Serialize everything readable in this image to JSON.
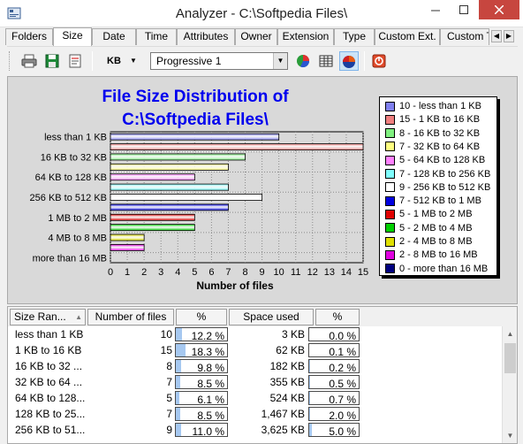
{
  "window": {
    "title": "Analyzer - C:\\Softpedia Files\\"
  },
  "tabs": [
    {
      "label": "Folders"
    },
    {
      "label": "Size"
    },
    {
      "label": "Date"
    },
    {
      "label": "Time"
    },
    {
      "label": "Attributes"
    },
    {
      "label": "Owner"
    },
    {
      "label": "Extension"
    },
    {
      "label": "Type"
    },
    {
      "label": "Custom Ext."
    },
    {
      "label": "Custom Type"
    }
  ],
  "active_tab": "Size",
  "toolbar": {
    "unit_label": "KB",
    "mode_value": "Progressive 1",
    "icons": [
      "print-icon",
      "save-icon",
      "properties-icon",
      "pie-chart-icon",
      "grid-icon",
      "bar-chart-icon",
      "stop-icon"
    ]
  },
  "chart_data": {
    "type": "bar",
    "orientation": "horizontal",
    "title_line1": "File Size Distribution of",
    "title_line2": "C:\\Softpedia Files\\",
    "xlabel": "Number of files",
    "xlim": [
      0,
      15
    ],
    "xticks": [
      "0",
      "1",
      "2",
      "3",
      "4",
      "5",
      "6",
      "7",
      "8",
      "9",
      "10",
      "11",
      "12",
      "13",
      "14",
      "15"
    ],
    "grid": true,
    "categories": [
      "less than 1 KB",
      "1 KB to 16 KB",
      "16 KB to 32 KB",
      "32 KB to 64 KB",
      "64 KB to 128 KB",
      "128 KB to 256 KB",
      "256 KB to 512 KB",
      "512 KB to 1 MB",
      "1 MB to 2 MB",
      "2 MB to 4 MB",
      "4 MB to 8 MB",
      "8 MB to 16 MB",
      "more than 16 MB"
    ],
    "tick_labels": [
      "less than 1 KB",
      "16 KB to 32 KB",
      "64 KB to 128 KB",
      "256 KB to 512 KB",
      "1 MB to 2 MB",
      "4 MB to 8 MB",
      "more than 16 MB"
    ],
    "values": [
      10,
      15,
      8,
      7,
      5,
      7,
      9,
      7,
      5,
      5,
      2,
      2,
      0
    ],
    "colors": [
      "#8080f0",
      "#f08080",
      "#80f080",
      "#ffff80",
      "#ff80ff",
      "#80ffff",
      "#ffffff",
      "#0000e0",
      "#e00000",
      "#00d000",
      "#e0e000",
      "#e000e0",
      "#000080"
    ],
    "legend_position": "right",
    "legend": [
      "10 - less than 1 KB",
      "15 - 1 KB to 16 KB",
      "8 - 16 KB to 32 KB",
      "7 - 32 KB to 64 KB",
      "5 - 64 KB to 128 KB",
      "7 - 128 KB to 256 KB",
      "9 - 256 KB to 512 KB",
      "7 - 512 KB to 1 MB",
      "5 - 1 MB to 2 MB",
      "5 - 2 MB to 4 MB",
      "2 - 4 MB to 8 MB",
      "2 - 8 MB to 16 MB",
      "0 - more than 16 MB"
    ]
  },
  "table": {
    "headers": [
      "Size Ran...",
      "Number of files",
      "%",
      "Space used",
      "%"
    ],
    "rows": [
      {
        "range": "less than 1 KB",
        "files": "10",
        "pct": "12.2 %",
        "pct_value": 12.2,
        "space": "3 KB",
        "space_pct": "0.0 %",
        "space_pct_value": 0.0
      },
      {
        "range": "1 KB to 16 KB",
        "files": "15",
        "pct": "18.3 %",
        "pct_value": 18.3,
        "space": "62 KB",
        "space_pct": "0.1 %",
        "space_pct_value": 0.1
      },
      {
        "range": "16 KB to 32 ...",
        "files": "8",
        "pct": "9.8 %",
        "pct_value": 9.8,
        "space": "182 KB",
        "space_pct": "0.2 %",
        "space_pct_value": 0.2
      },
      {
        "range": "32 KB to 64 ...",
        "files": "7",
        "pct": "8.5 %",
        "pct_value": 8.5,
        "space": "355 KB",
        "space_pct": "0.5 %",
        "space_pct_value": 0.5
      },
      {
        "range": "64 KB to 128...",
        "files": "5",
        "pct": "6.1 %",
        "pct_value": 6.1,
        "space": "524 KB",
        "space_pct": "0.7 %",
        "space_pct_value": 0.7
      },
      {
        "range": "128 KB to 25...",
        "files": "7",
        "pct": "8.5 %",
        "pct_value": 8.5,
        "space": "1,467 KB",
        "space_pct": "2.0 %",
        "space_pct_value": 2.0
      },
      {
        "range": "256 KB to 51...",
        "files": "9",
        "pct": "11.0 %",
        "pct_value": 11.0,
        "space": "3,625 KB",
        "space_pct": "5.0 %",
        "space_pct_value": 5.0
      }
    ]
  }
}
